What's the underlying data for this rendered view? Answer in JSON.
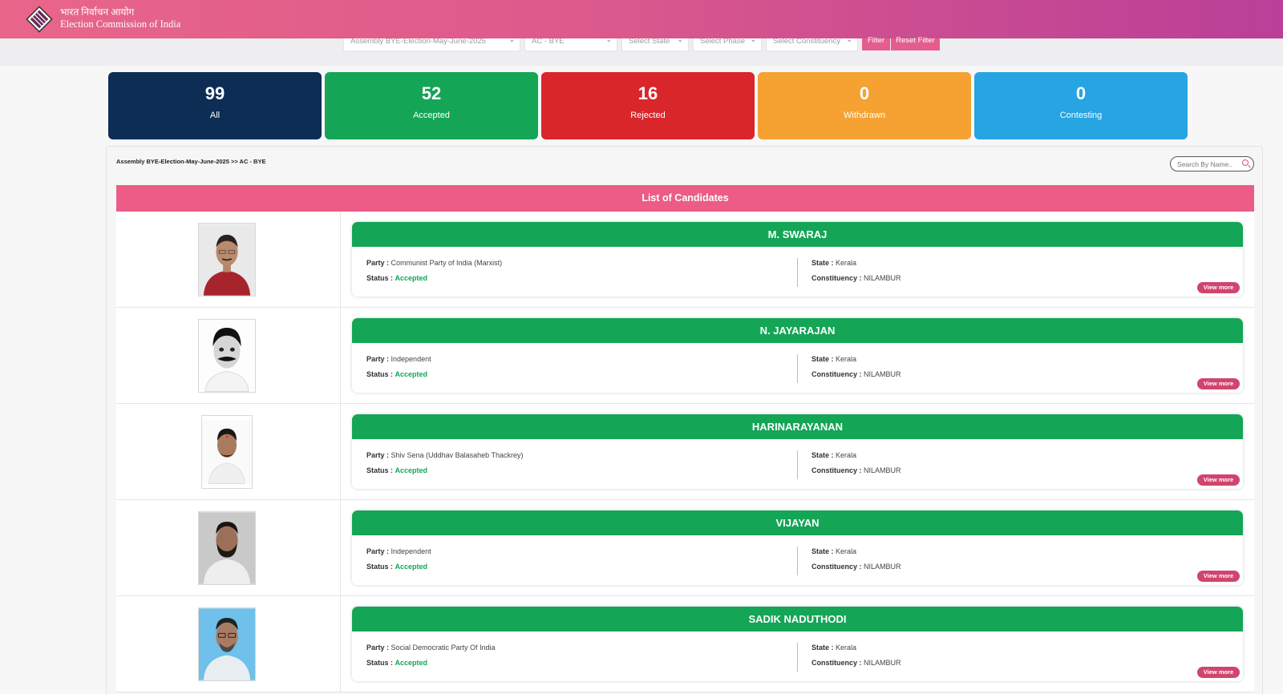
{
  "header": {
    "title_hindi": "भारत निर्वाचन आयोग",
    "title_english": "Election Commission of India"
  },
  "filters": {
    "election": "Assembly BYE-Election-May-June-2025",
    "type": "AC - BYE",
    "state": "Select State",
    "phase": "Select Phase",
    "constituency": "Select Constituency",
    "filter_label": "Filter",
    "reset_label": "Reset Filter"
  },
  "stats": [
    {
      "value": "99",
      "label": "All",
      "color": "#0d2d55"
    },
    {
      "value": "52",
      "label": "Accepted",
      "color": "#14a556"
    },
    {
      "value": "16",
      "label": "Rejected",
      "color": "#d8262b"
    },
    {
      "value": "0",
      "label": "Withdrawn",
      "color": "#f5a232"
    },
    {
      "value": "0",
      "label": "Contesting",
      "color": "#27a4e2"
    }
  ],
  "breadcrumb": "Assembly BYE-Election-May-June-2025 >> AC - BYE",
  "search": {
    "placeholder": "Search By Name.."
  },
  "list_title": "List of Candidates",
  "labels": {
    "party": "Party :",
    "status": "Status :",
    "state": "State :",
    "constituency": "Constituency :",
    "view_more": "View more"
  },
  "candidates": [
    {
      "name": "M. SWARAJ",
      "party": "Communist Party of India (Marxist)",
      "status": "Accepted",
      "state": "Kerala",
      "constituency": "NILAMBUR"
    },
    {
      "name": "N. JAYARAJAN",
      "party": "Independent",
      "status": "Accepted",
      "state": "Kerala",
      "constituency": "NILAMBUR"
    },
    {
      "name": "HARINARAYANAN",
      "party": "Shiv Sena (Uddhav Balasaheb Thackrey)",
      "status": "Accepted",
      "state": "Kerala",
      "constituency": "NILAMBUR"
    },
    {
      "name": "VIJAYAN",
      "party": "Independent",
      "status": "Accepted",
      "state": "Kerala",
      "constituency": "NILAMBUR"
    },
    {
      "name": "SADIK NADUTHODI",
      "party": "Social Democratic Party Of India",
      "status": "Accepted",
      "state": "Kerala",
      "constituency": "NILAMBUR"
    }
  ]
}
